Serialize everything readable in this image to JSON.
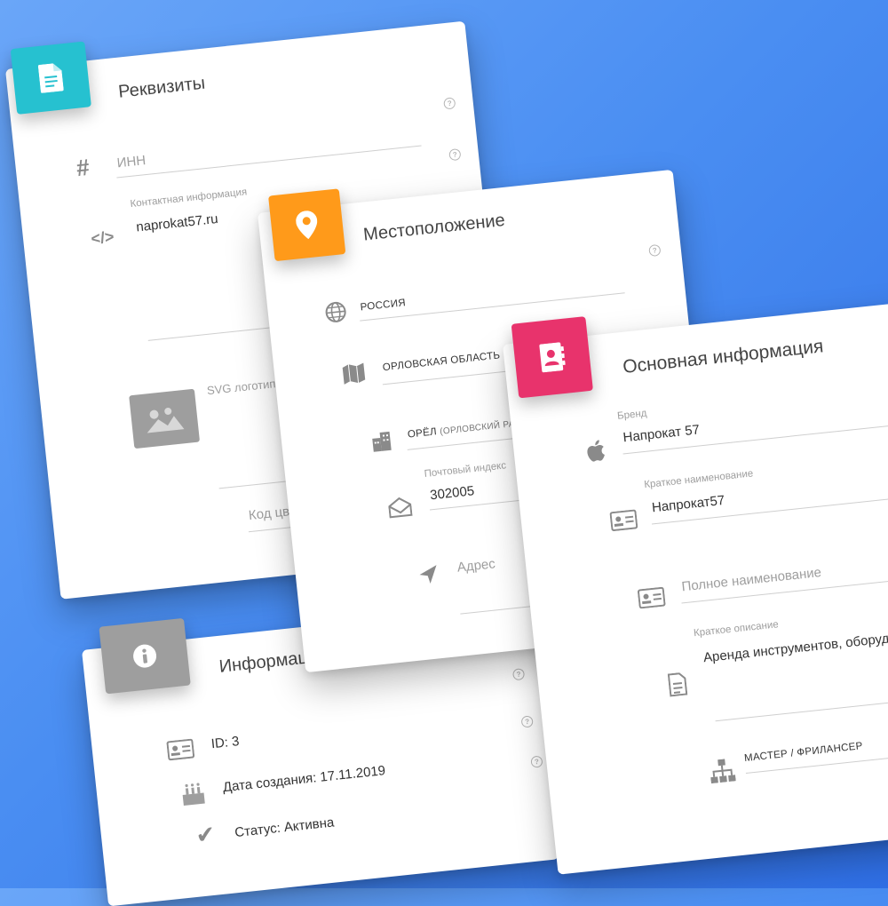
{
  "requisites": {
    "title": "Реквизиты",
    "inn_placeholder": "ИНН",
    "contact_label": "Контактная информация",
    "contact_value": "naprokat57.ru",
    "logo_label": "SVG логотип",
    "bg_color_placeholder": "Код цвета фона",
    "accent_color": "#26c1d0"
  },
  "location": {
    "title": "Местоположение",
    "country": "РОССИЯ",
    "region": "ОРЛОВСКАЯ ОБЛАСТЬ",
    "city": "ОРЁЛ",
    "city_sub": "(ОРЛОВСКИЙ РАЙОН)",
    "postal_label": "Почтовый индекс",
    "postal_value": "302005",
    "address_placeholder": "Адрес",
    "accent_color": "#ff9a1a"
  },
  "main_info": {
    "title": "Основная информация",
    "brand_label": "Бренд",
    "brand_value": "Напрокат 57",
    "short_name_label": "Краткое наименование",
    "short_name_value": "Напрокат57",
    "full_name_placeholder": "Полное наименование",
    "short_desc_label": "Краткое описание",
    "short_desc_value": "Аренда инструментов, оборудова",
    "category": "МАСТЕР / ФРИЛАНСЕР",
    "accent_color": "#e8336c"
  },
  "information": {
    "title": "Информация",
    "id_text": "ID: 3",
    "created_text": "Дата создания: 17.11.2019",
    "status_text": "Статус: Активна",
    "accent_color": "#9e9e9e"
  }
}
